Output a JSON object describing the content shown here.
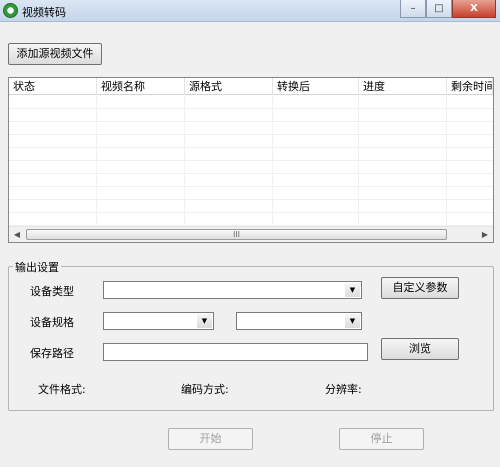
{
  "window": {
    "title": "视频转码",
    "minimize": "–",
    "maximize": "□",
    "close": "X"
  },
  "toolbar": {
    "add_label": "添加源视频文件"
  },
  "list": {
    "columns": [
      "状态",
      "视频名称",
      "源格式",
      "转换后",
      "进度",
      "剩余时间"
    ],
    "scroll_left": "◀",
    "scroll_right": "▶",
    "thumb_grip": "III"
  },
  "output": {
    "legend": "输出设置",
    "device_type_label": "设备类型",
    "device_type_value": "",
    "custom_params_label": "自定义参数",
    "device_spec_label": "设备规格",
    "spec_a_value": "",
    "spec_b_value": "",
    "save_path_label": "保存路径",
    "save_path_value": "",
    "browse_label": "浏览",
    "file_format_label": "文件格式:",
    "encoding_label": "编码方式:",
    "resolution_label": "分辨率:",
    "combo_arrow": "▼"
  },
  "actions": {
    "start_label": "开始",
    "stop_label": "停止"
  }
}
